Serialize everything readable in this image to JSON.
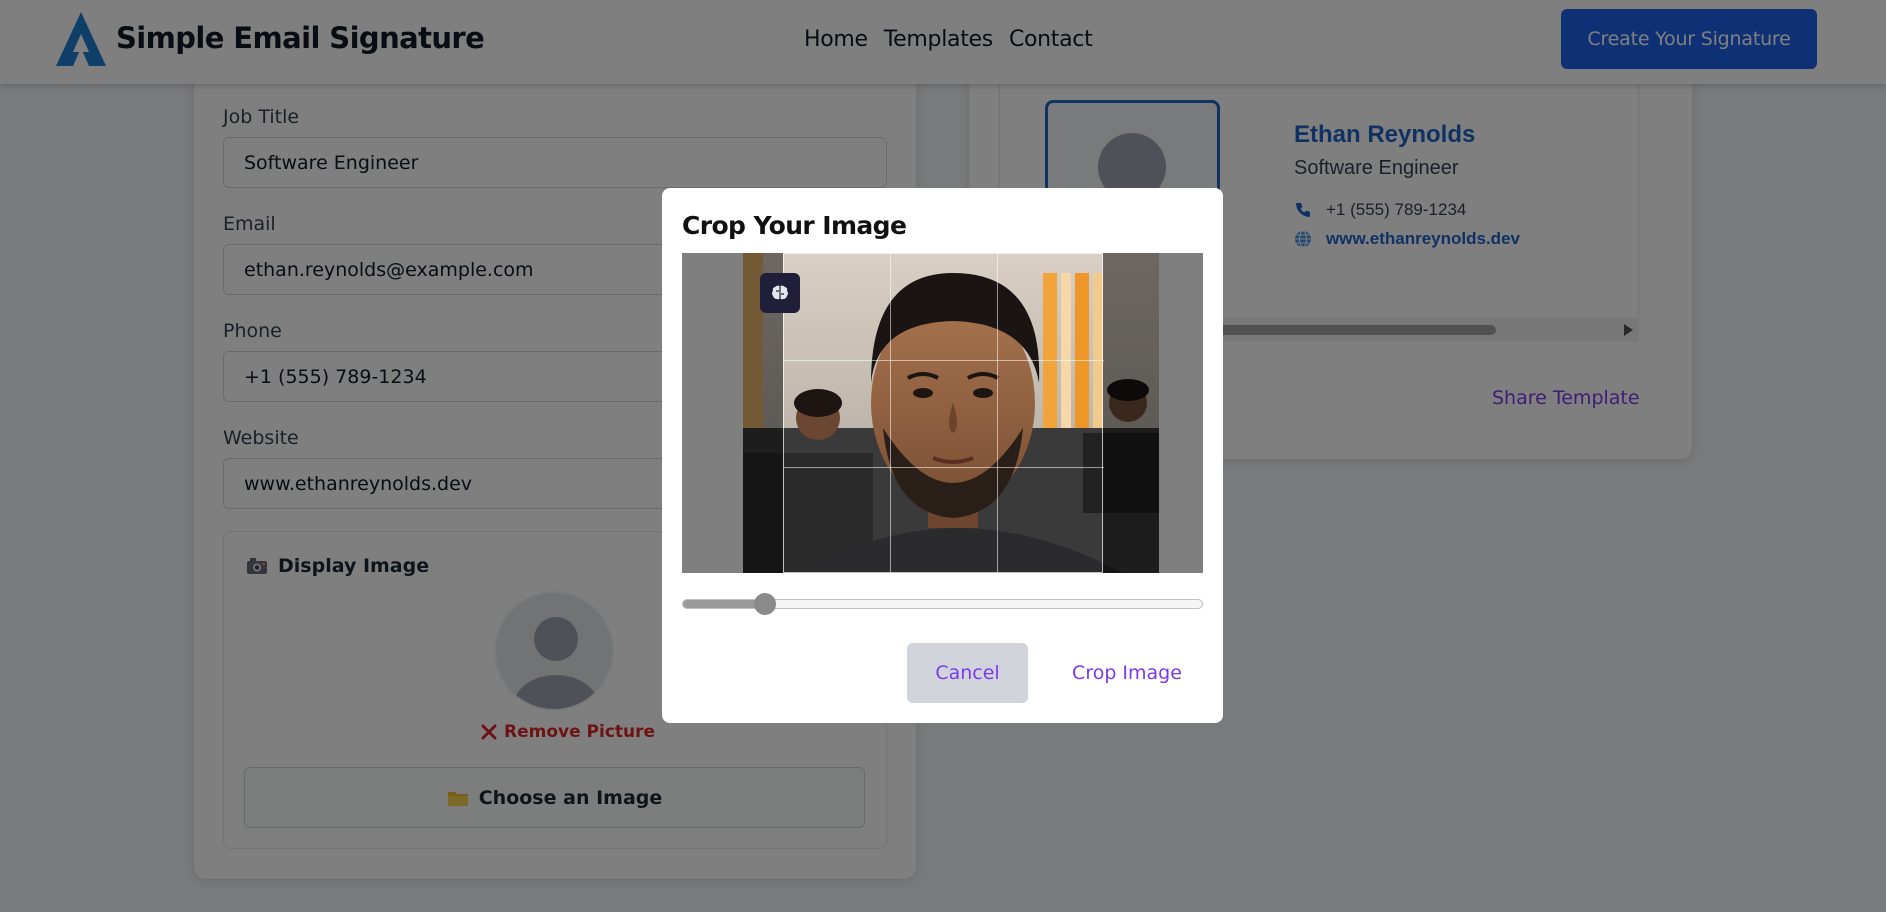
{
  "header": {
    "brand": "Simple Email Signature",
    "nav": [
      "Home",
      "Templates",
      "Contact"
    ],
    "cta_label": "Create Your Signature",
    "accent_color": "#1d63ed"
  },
  "form": {
    "fields": [
      {
        "label": "Job Title",
        "value": "Software Engineer"
      },
      {
        "label": "Email",
        "value": "ethan.reynolds@example.com"
      },
      {
        "label": "Phone",
        "value": "+1 (555) 789-1234"
      },
      {
        "label": "Website",
        "value": "www.ethanreynolds.dev"
      }
    ],
    "display_image": {
      "title": "Display Image",
      "title_icon": "camera-icon",
      "remove_label": "Remove Picture",
      "choose_label": "Choose an Image",
      "choose_icon": "folder-icon"
    }
  },
  "preview": {
    "name": "Ethan Reynolds",
    "title": "Software Engineer",
    "phone": "+1 (555) 789-1234",
    "website": "www.ethanreynolds.dev",
    "share_label": "Share Template",
    "name_color": "#1e63c6"
  },
  "modal": {
    "title": "Crop Your Image",
    "zoom_level": 0.16,
    "cancel_label": "Cancel",
    "crop_label": "Crop Image",
    "ai_icon": "brain-icon"
  }
}
